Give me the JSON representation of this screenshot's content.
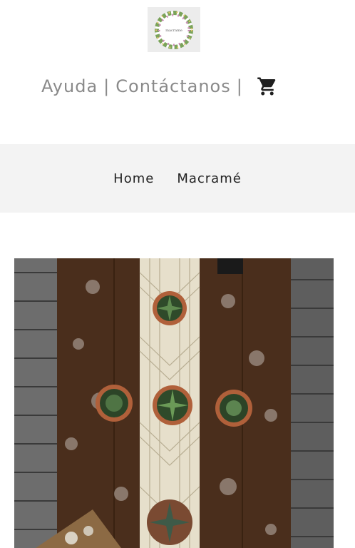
{
  "header": {
    "logo": {
      "icon": "wreath-logo-icon",
      "text": "macrame"
    },
    "links": [
      {
        "label": "Ayuda"
      },
      {
        "label": "Contáctanos"
      }
    ],
    "separator": "|",
    "cart": {
      "icon": "shopping-cart-icon"
    }
  },
  "nav": {
    "items": [
      {
        "label": "Home"
      },
      {
        "label": "Macramé"
      }
    ]
  },
  "hero": {
    "image": "macrame-table-runner-with-succulents-photo"
  },
  "colors": {
    "link_gray": "#8a8a8a",
    "nav_bg": "#f3f3f3",
    "wood": "#4a2e1c",
    "macrame": "#e8e2cf"
  }
}
